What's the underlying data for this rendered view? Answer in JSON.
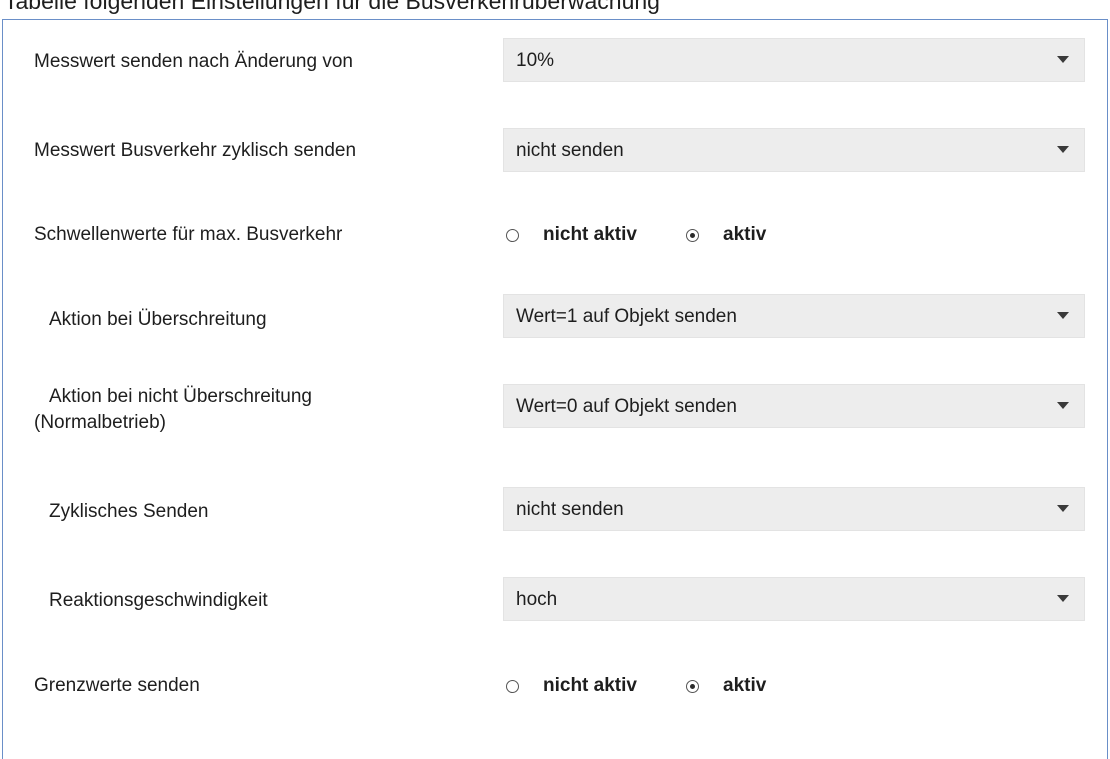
{
  "caption": "Tabelle folgenden Einstellungen für die Busverkehrüberwachung",
  "rows": [
    {
      "label": "Messwert senden nach Änderung von",
      "value": "10%"
    },
    {
      "label": "Messwert Busverkehr zyklisch senden",
      "value": "nicht senden"
    },
    {
      "label": "Schwellenwerte für max. Busverkehr",
      "options": [
        "nicht aktiv",
        "aktiv"
      ],
      "selected": "aktiv"
    },
    {
      "label": "Aktion bei Überschreitung",
      "value": "Wert=1 auf Objekt senden"
    },
    {
      "label_line1": "Aktion bei nicht Überschreitung",
      "label_line2": "(Normalbetrieb)",
      "value": "Wert=0 auf Objekt senden"
    },
    {
      "label": "Zyklisches Senden",
      "value": "nicht senden"
    },
    {
      "label": "Reaktionsgeschwindigkeit",
      "value": "hoch"
    },
    {
      "label": "Grenzwerte senden",
      "options": [
        "nicht aktiv",
        "aktiv"
      ],
      "selected": "aktiv"
    }
  ]
}
